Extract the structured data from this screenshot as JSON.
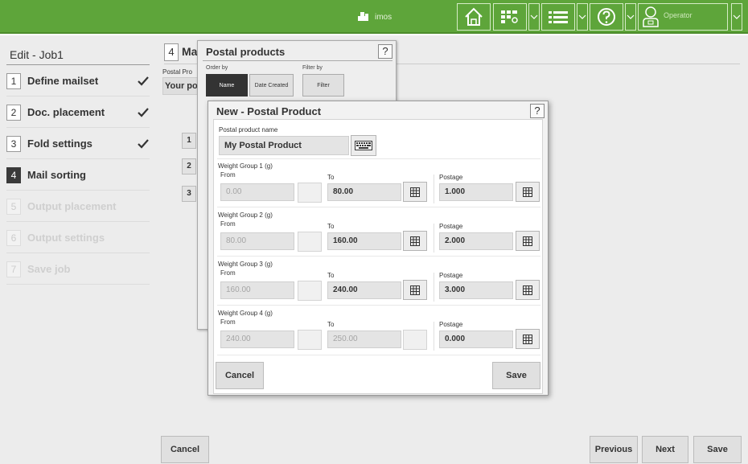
{
  "topbar": {
    "brand_label": "imos",
    "operator_label": "Operator",
    "icons": [
      "printer-icon",
      "home-icon",
      "apps-icon",
      "list-icon",
      "help-icon",
      "user-icon"
    ]
  },
  "sidebar": {
    "title": "Edit - Job1",
    "steps": [
      {
        "num": "1",
        "label": "Define mailset",
        "state": "done"
      },
      {
        "num": "2",
        "label": "Doc. placement",
        "state": "done"
      },
      {
        "num": "3",
        "label": "Fold settings",
        "state": "done"
      },
      {
        "num": "4",
        "label": "Mail sorting",
        "state": "active"
      },
      {
        "num": "5",
        "label": "Output placement",
        "state": "disabled"
      },
      {
        "num": "6",
        "label": "Output settings",
        "state": "disabled"
      },
      {
        "num": "7",
        "label": "Save job",
        "state": "disabled"
      }
    ]
  },
  "main": {
    "step_num": "4",
    "title": "Ma",
    "postal_product_label": "Postal Pro",
    "postal_product_value": "Your po",
    "bg_numbers": [
      "1",
      "2",
      "3"
    ]
  },
  "panel": {
    "title": "Postal products",
    "help": "?",
    "order_by_label": "Order by",
    "filter_by_label": "Filter by",
    "order_name": "Name",
    "order_date": "Date Created",
    "filter": "Filter"
  },
  "modal": {
    "title": "New - Postal Product",
    "help": "?",
    "name_label": "Postal product name",
    "name_value": "My Postal Product",
    "from_label": "From",
    "to_label": "To",
    "postage_label": "Postage",
    "groups": [
      {
        "label": "Weight Group 1 (g)",
        "from": "0.00",
        "to": "80.00",
        "postage": "1.000"
      },
      {
        "label": "Weight Group 2 (g)",
        "from": "80.00",
        "to": "160.00",
        "postage": "2.000"
      },
      {
        "label": "Weight Group 3 (g)",
        "from": "160.00",
        "to": "240.00",
        "postage": "3.000"
      },
      {
        "label": "Weight Group 4 (g)",
        "from": "240.00",
        "to": "250.00",
        "postage": "0.000"
      }
    ],
    "cancel_label": "Cancel",
    "save_label": "Save"
  },
  "footer": {
    "cancel_label": "Cancel",
    "previous_label": "Previous",
    "next_label": "Next",
    "save_label": "Save"
  },
  "colors": {
    "topbar": "#5ea53a",
    "active_step": "#3a3a3a",
    "check": "#333333"
  }
}
